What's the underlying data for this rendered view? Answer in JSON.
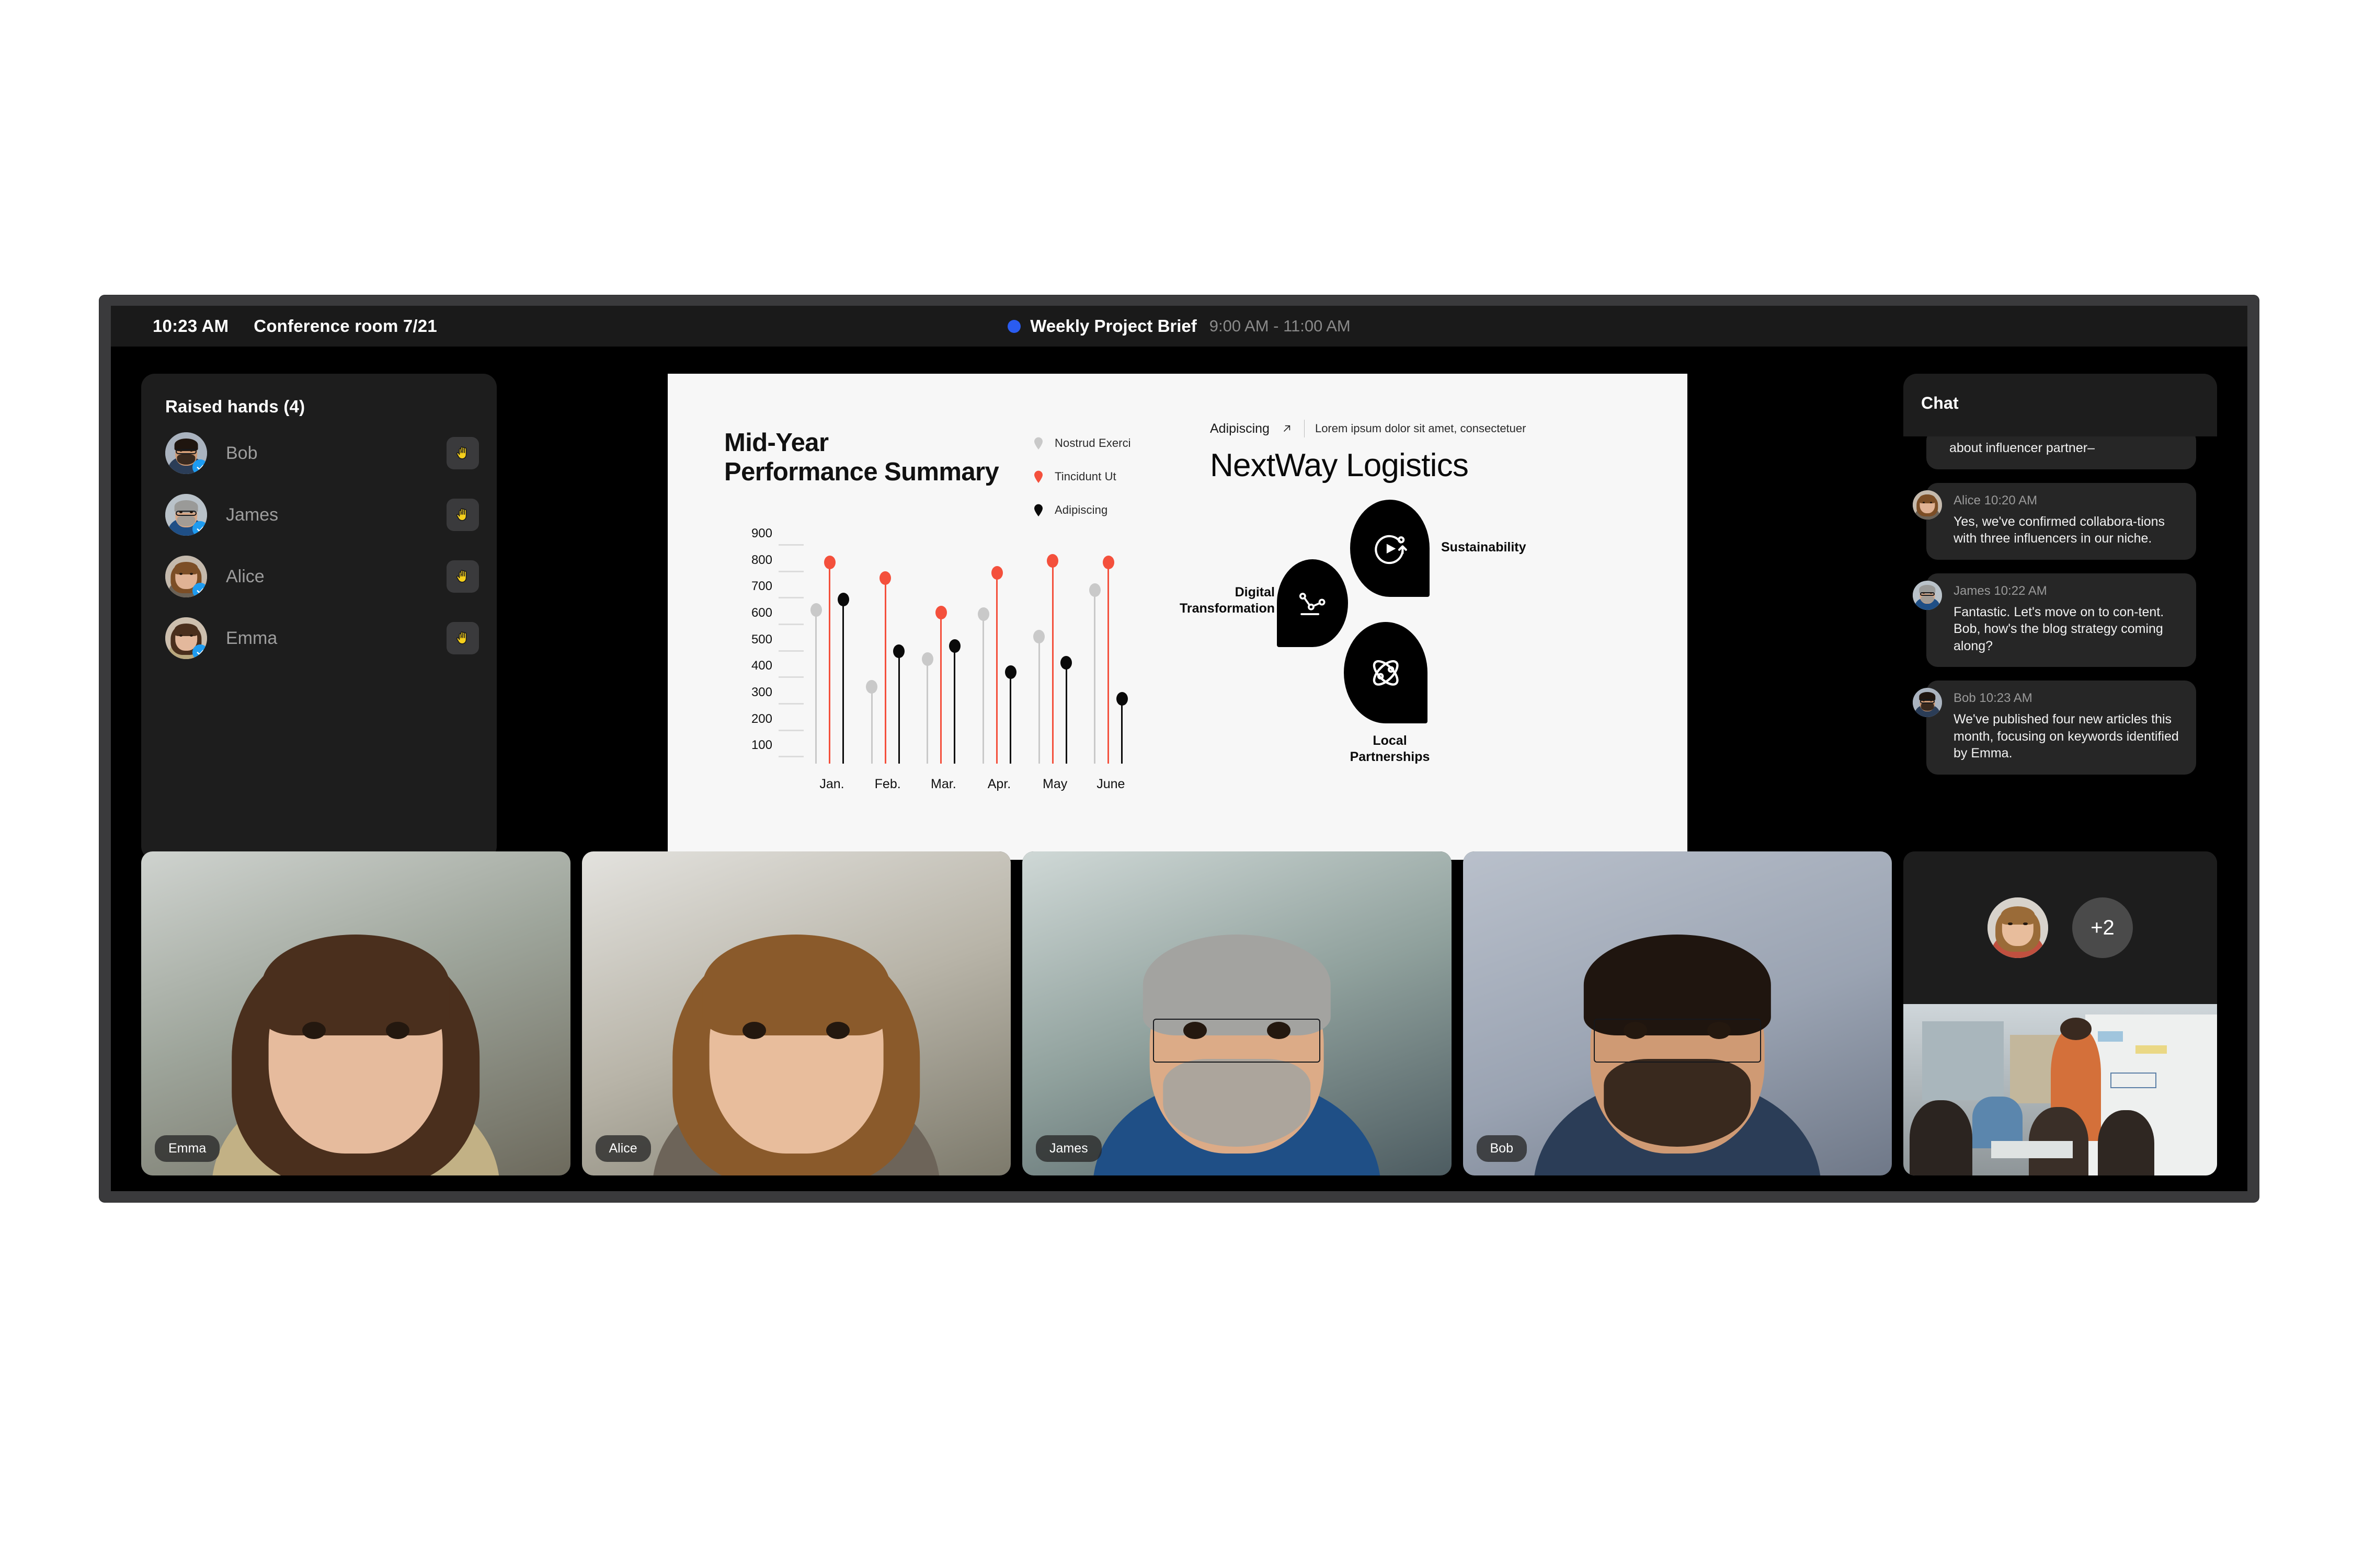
{
  "topbar": {
    "clock": "10:23 AM",
    "room": "Conference room 7/21",
    "meeting_title": "Weekly Project Brief",
    "meeting_time": "9:00 AM  -  11:00 AM",
    "status_dot_color": "#2a5cf0"
  },
  "raised_hands": {
    "title": "Raised hands  (4)",
    "people": [
      {
        "name": "Bob",
        "verified": true,
        "hand_icon": "raised-hand-icon"
      },
      {
        "name": "James",
        "verified": true,
        "hand_icon": "raised-hand-icon"
      },
      {
        "name": "Alice",
        "verified": true,
        "hand_icon": "raised-hand-icon"
      },
      {
        "name": "Emma",
        "verified": true,
        "hand_icon": "raised-hand-icon"
      }
    ]
  },
  "slide": {
    "kicker_word": "Adipiscing",
    "kicker_sub": "Lorem ipsum dolor sit amet, consectetuer",
    "headline": "NextWay Logistics",
    "pillars": [
      {
        "label": "Digital\nTransformation",
        "icon": "line-chart-icon"
      },
      {
        "label": "Sustainability",
        "icon": "recycle-play-icon"
      },
      {
        "label": "Local\nPartnerships",
        "icon": "atom-icon"
      }
    ]
  },
  "chart_data": {
    "type": "bar",
    "title": "Mid-Year\nPerformance Summary",
    "xlabel": "",
    "ylabel": "",
    "ylim": [
      0,
      900
    ],
    "yticks": [
      900,
      800,
      700,
      600,
      500,
      400,
      300,
      200,
      100
    ],
    "grid": true,
    "legend_position": "top-right",
    "categories": [
      "Jan.",
      "Feb.",
      "Mar.",
      "Apr.",
      "May",
      "June"
    ],
    "series": [
      {
        "name": "Nostrud Exerci",
        "color": "#c9c9c9",
        "values": [
          580,
          290,
          395,
          565,
          480,
          655
        ]
      },
      {
        "name": "Tincidunt Ut",
        "color": "#f4503c",
        "values": [
          760,
          700,
          570,
          720,
          765,
          760
        ]
      },
      {
        "name": "Adipiscing",
        "color": "#0a0a0a",
        "values": [
          620,
          425,
          445,
          345,
          380,
          245
        ]
      }
    ]
  },
  "chat": {
    "title": "Chat",
    "messages": [
      {
        "author": "",
        "time": "",
        "text": "about influencer partner–",
        "cut_off": true,
        "avatar": false
      },
      {
        "author": "Alice",
        "time": "10:20 AM",
        "meta": "Alice 10:20 AM",
        "text": "Yes, we've confirmed collabora-tions with three influencers in our niche.",
        "avatar": true
      },
      {
        "author": "James",
        "time": "10:22 AM",
        "meta": "James 10:22 AM",
        "text": "Fantastic. Let's move on to con-tent. Bob, how's the blog strategy coming along?",
        "avatar": true
      },
      {
        "author": "Bob",
        "time": "10:23 AM",
        "meta": "Bob 10:23 AM",
        "text": "We've published four new articles this month, focusing on keywords identified by Emma.",
        "avatar": true
      }
    ]
  },
  "tiles": {
    "participants": [
      {
        "name": "Emma"
      },
      {
        "name": "Alice"
      },
      {
        "name": "James"
      },
      {
        "name": "Bob"
      }
    ],
    "overflow_count": "+2"
  }
}
